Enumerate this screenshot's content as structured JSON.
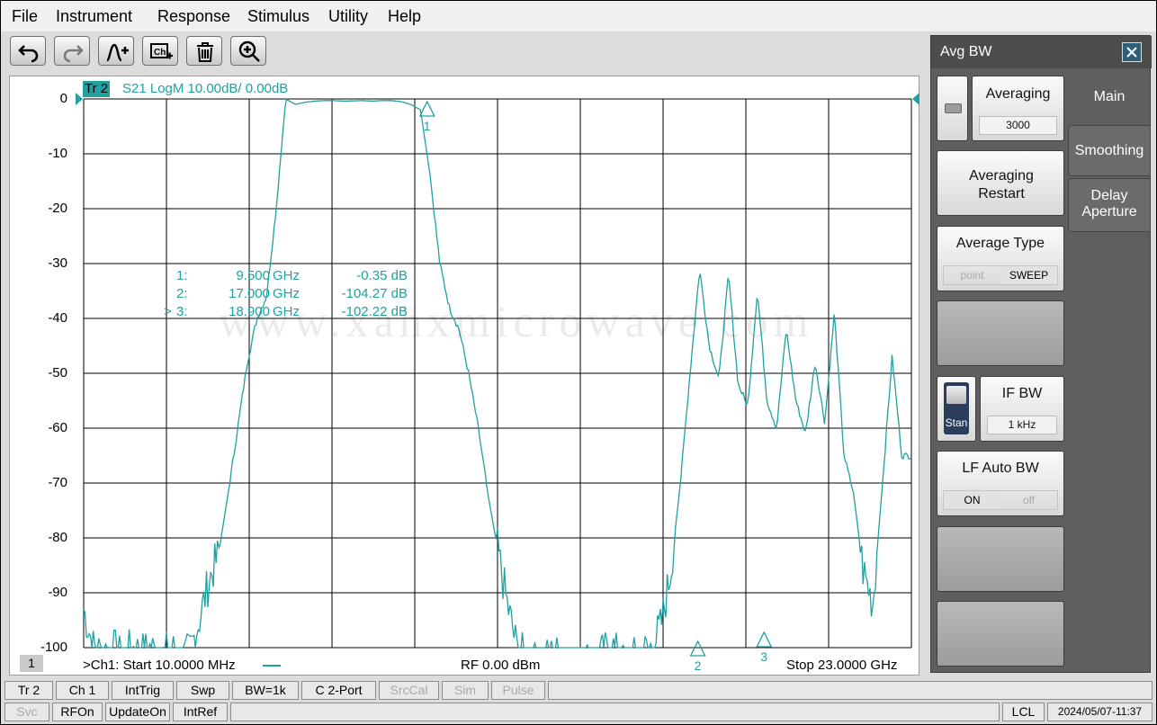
{
  "menu": [
    "File",
    "Instrument",
    "Response",
    "Stimulus",
    "Utility",
    "Help"
  ],
  "toolbar": {
    "icons": [
      "undo-icon",
      "redo-icon",
      "marker-add-icon",
      "channel-add-icon",
      "trash-icon",
      "zoom-in-icon"
    ]
  },
  "trace": {
    "badge": "Tr 2",
    "title": "S21 LogM 10.00dB/  0.00dB",
    "color": "#21a0a0"
  },
  "y_labels": [
    "0",
    "-10",
    "-20",
    "-30",
    "-40",
    "-50",
    "-60",
    "-70",
    "-80",
    "-90",
    "-100"
  ],
  "markers": [
    {
      "id": "1:",
      "freq": "9.500",
      "unit": "GHz",
      "value": "-0.35 dB",
      "prefix": ""
    },
    {
      "id": "2:",
      "freq": "17.000",
      "unit": "GHz",
      "value": "-104.27 dB",
      "prefix": ""
    },
    {
      "id": "3:",
      "freq": "18.900",
      "unit": "GHz",
      "value": "-102.22 dB",
      "prefix": ">"
    }
  ],
  "marker_flags": [
    "1",
    "2",
    "3"
  ],
  "watermark": "www.xahxmicrowave.com",
  "channel_number": "1",
  "bottom": {
    "start": ">Ch1:  Start   10.0000 MHz",
    "rf": "RF     0.00 dBm",
    "stop": "Stop  23.0000 GHz"
  },
  "chart_data": {
    "type": "line",
    "series": [
      {
        "values_db": [
          -93,
          -100,
          -101,
          -100,
          -102,
          -100,
          -101,
          -100,
          -102,
          -100,
          -102,
          -101,
          -95,
          -88,
          -83,
          -72,
          -60,
          -48,
          -40,
          -36,
          -20,
          0,
          -1,
          -0.6,
          -0.4,
          -0.3,
          -0.3,
          -0.4,
          -0.35,
          -0.3,
          -0.4,
          -0.3,
          -0.3,
          -0.5,
          -1,
          -2,
          -14,
          -30,
          -38,
          -42,
          -50,
          -60,
          -72,
          -82,
          -92,
          -100,
          -102,
          -103,
          -102,
          -101,
          -103,
          -104,
          -102,
          -103,
          -101,
          -100,
          -103,
          -102,
          -101,
          -100,
          -96,
          -86,
          -70,
          -50,
          -31,
          -45,
          -51,
          -32,
          -52,
          -56,
          -35,
          -55,
          -60,
          -42,
          -55,
          -61,
          -48,
          -59,
          -39,
          -65,
          -72,
          -86,
          -92,
          -70,
          -47,
          -65,
          -65
        ]
      }
    ],
    "x_start_mhz": 10,
    "x_stop_ghz": 23,
    "ylim": [
      -100,
      0
    ],
    "grid": true
  },
  "panel": {
    "title": "Avg BW",
    "tabs": [
      "Main",
      "Smoothing",
      "Delay Aperture"
    ],
    "softkeys": {
      "averaging": {
        "label": "Averaging",
        "value": "3000"
      },
      "restart": {
        "label": "Averaging Restart"
      },
      "avg_type": {
        "label": "Average Type",
        "opt1": "point",
        "opt2": "SWEEP"
      },
      "ifbw": {
        "label": "IF BW",
        "value": "1 kHz",
        "side": "Stan"
      },
      "lf_auto": {
        "label": "LF Auto BW",
        "opt1": "ON",
        "opt2": "off"
      }
    }
  },
  "status1": [
    "Tr 2",
    "Ch 1",
    "IntTrig",
    "Swp",
    "BW=1k",
    "C  2-Port",
    "SrcCal",
    "Sim",
    "Pulse"
  ],
  "status2": [
    "Svc",
    "RFOn",
    "UpdateOn",
    "IntRef",
    "LCL",
    "2024/05/07-11:37"
  ]
}
